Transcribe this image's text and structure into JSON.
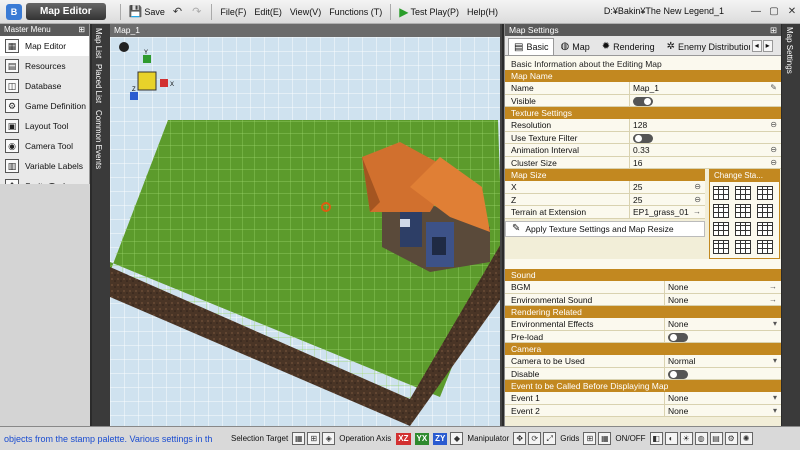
{
  "titlebar": {
    "app_title": "Map Editor",
    "save": "Save",
    "menus": [
      "File(F)",
      "Edit(E)",
      "View(V)",
      "Functions (T)"
    ],
    "test_play": "Test Play(P)",
    "help": "Help(H)",
    "project_path": "D:¥Bakin¥The New Legend_1"
  },
  "master_menu": {
    "title": "Master Menu",
    "items": [
      {
        "label": "Map Editor",
        "icon": "map-icon",
        "active": true
      },
      {
        "label": "Resources",
        "icon": "resources-icon"
      },
      {
        "label": "Database",
        "icon": "database-icon"
      },
      {
        "label": "Game Definition",
        "icon": "game-definition-icon"
      },
      {
        "label": "Layout Tool",
        "icon": "layout-icon"
      },
      {
        "label": "Camera Tool",
        "icon": "camera-icon"
      },
      {
        "label": "Variable Labels",
        "icon": "variable-icon"
      },
      {
        "label": "Sprite Tool",
        "icon": "sprite-icon"
      }
    ]
  },
  "vertical_tabs": [
    "Map List",
    "Placed List",
    "Common Events"
  ],
  "viewport": {
    "title": "Map_1"
  },
  "map_settings": {
    "title": "Map Settings",
    "right_tab": "Map Settings",
    "tabs": [
      "Basic",
      "Map",
      "Rendering",
      "Enemy Distribution"
    ],
    "description": "Basic Information about the Editing Map",
    "map_name": {
      "section": "Map Name",
      "name_label": "Name",
      "name_value": "Map_1",
      "visible_label": "Visible"
    },
    "texture": {
      "section": "Texture Settings",
      "resolution_label": "Resolution",
      "resolution_value": "128",
      "filter_label": "Use Texture Filter",
      "anim_label": "Animation Interval",
      "anim_value": "0.33",
      "cluster_label": "Cluster Size",
      "cluster_value": "16"
    },
    "map_size": {
      "section": "Map Size",
      "x_label": "X",
      "x_value": "25",
      "z_label": "Z",
      "z_value": "25",
      "terrain_label": "Terrain at Extension",
      "terrain_value": "EP1_grass_01",
      "change_stamp": "Change Sta...",
      "apply_button": "Apply Texture Settings and Map Resize"
    },
    "sound": {
      "section": "Sound",
      "bgm_label": "BGM",
      "bgm_value": "None",
      "env_label": "Environmental Sound",
      "env_value": "None"
    },
    "rendering": {
      "section": "Rendering Related",
      "effects_label": "Environmental Effects",
      "effects_value": "None",
      "preload_label": "Pre-load"
    },
    "camera": {
      "section": "Camera",
      "used_label": "Camera to be Used",
      "used_value": "Normal",
      "disable_label": "Disable"
    },
    "events": {
      "section": "Event to be Called Before Displaying Map",
      "event1_label": "Event 1",
      "event1_value": "None",
      "event2_label": "Event 2",
      "event2_value": "None"
    }
  },
  "statusbar": {
    "message": "objects from the stamp palette.  Various settings in th",
    "selection_target": "Selection Target",
    "operation_axis": "Operation Axis",
    "axes": [
      "XZ",
      "YX",
      "ZY"
    ],
    "manipulator": "Manipulator",
    "grids": "Grids",
    "onoff": "ON/OFF"
  },
  "colors": {
    "section_header": "#c28820",
    "grass": "#5c9b2c",
    "axis_xz": "#d23030",
    "axis_yx": "#2e8a2e",
    "axis_zy": "#2a5bd0"
  }
}
